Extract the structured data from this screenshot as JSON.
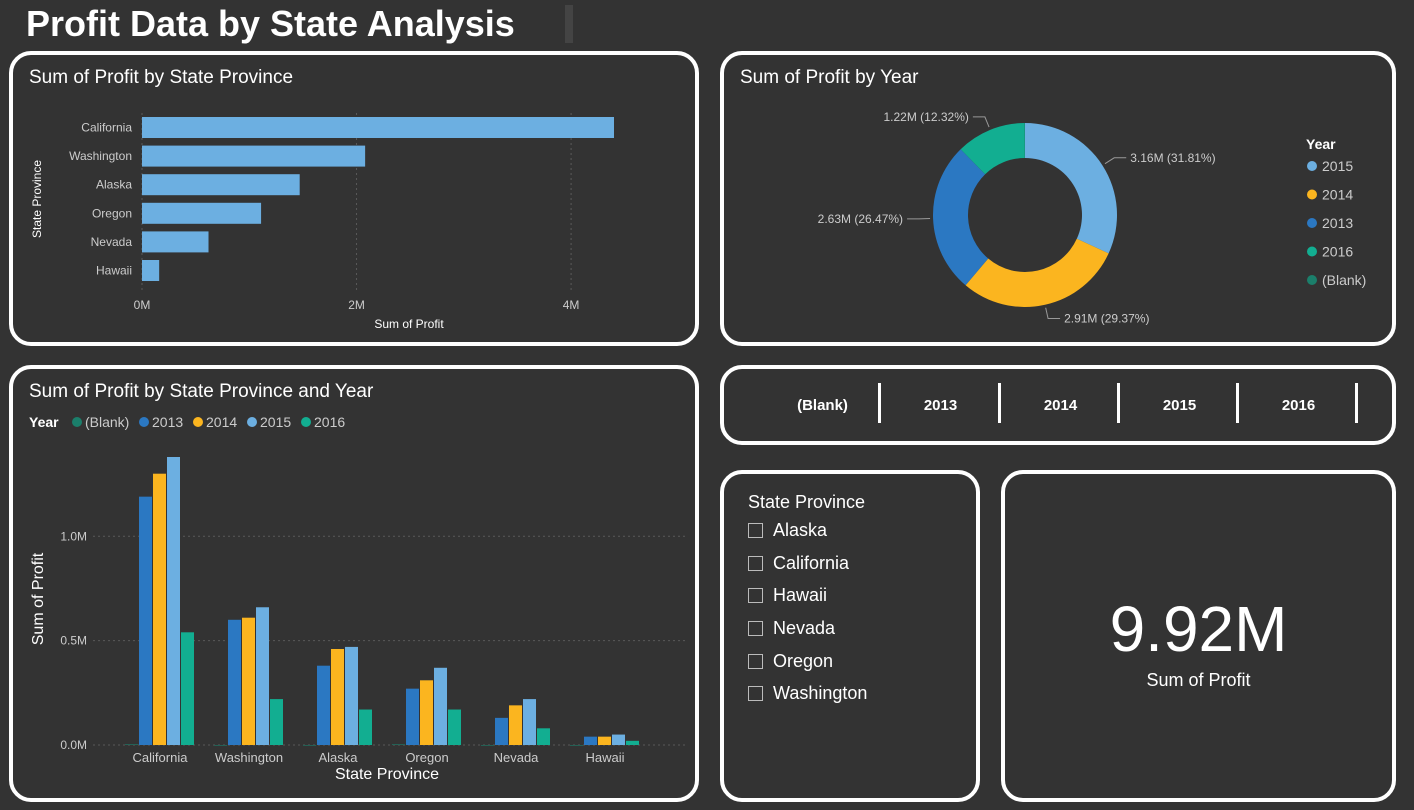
{
  "page": {
    "title": "Profit Data by State Analysis"
  },
  "colors": {
    "(Blank)": "#1b7f6b",
    "2013": "#2b78c2",
    "2014": "#fbb51f",
    "2015": "#6cafe1",
    "2016": "#12ae91",
    "bar": "#6cafe1"
  },
  "chart_data": [
    {
      "type": "bar",
      "orientation": "horizontal",
      "title": "Sum of Profit by State Province",
      "xlabel": "Sum of Profit",
      "ylabel": "State Province",
      "categories": [
        "California",
        "Washington",
        "Alaska",
        "Oregon",
        "Nevada",
        "Hawaii"
      ],
      "values": [
        4.4,
        2.08,
        1.47,
        1.11,
        0.62,
        0.16
      ],
      "unit": "M",
      "xlim": [
        0,
        4.4
      ],
      "xticks": [
        "0M",
        "2M",
        "4M"
      ],
      "grid": true
    },
    {
      "type": "pie",
      "donut": true,
      "title": "Sum of Profit by Year",
      "legend_title": "Year",
      "legend_position": "right",
      "slices": [
        {
          "label": "2015",
          "value": 3.16,
          "pct": 31.81,
          "text": "3.16M (31.81%)"
        },
        {
          "label": "2014",
          "value": 2.91,
          "pct": 29.37,
          "text": "2.91M (29.37%)"
        },
        {
          "label": "2013",
          "value": 2.63,
          "pct": 26.47,
          "text": "2.63M (26.47%)"
        },
        {
          "label": "2016",
          "value": 1.22,
          "pct": 12.32,
          "text": "1.22M (12.32%)"
        },
        {
          "label": "(Blank)",
          "value": 0.003,
          "pct": 0.03,
          "text": ""
        }
      ]
    },
    {
      "type": "bar",
      "orientation": "vertical",
      "title": "Sum of Profit by State Province and Year",
      "xlabel": "State Province",
      "ylabel": "Sum of Profit",
      "legend_title": "Year",
      "legend_position": "top-left",
      "categories": [
        "California",
        "Washington",
        "Alaska",
        "Oregon",
        "Nevada",
        "Hawaii"
      ],
      "series": [
        {
          "name": "(Blank)",
          "values": [
            0.003,
            0.0,
            0.0,
            0.003,
            0.0,
            0.0
          ]
        },
        {
          "name": "2013",
          "values": [
            1.19,
            0.6,
            0.38,
            0.27,
            0.13,
            0.04
          ]
        },
        {
          "name": "2014",
          "values": [
            1.3,
            0.61,
            0.46,
            0.31,
            0.19,
            0.04
          ]
        },
        {
          "name": "2015",
          "values": [
            1.38,
            0.66,
            0.47,
            0.37,
            0.22,
            0.05
          ]
        },
        {
          "name": "2016",
          "values": [
            0.54,
            0.22,
            0.17,
            0.17,
            0.08,
            0.02
          ]
        }
      ],
      "unit": "M",
      "ylim": [
        0,
        1.38
      ],
      "yticks": [
        "0.0M",
        "0.5M",
        "1.0M"
      ],
      "grid": true
    }
  ],
  "year_slicer": {
    "options": [
      "(Blank)",
      "2013",
      "2014",
      "2015",
      "2016"
    ]
  },
  "state_slicer": {
    "title": "State Province",
    "options": [
      "Alaska",
      "California",
      "Hawaii",
      "Nevada",
      "Oregon",
      "Washington"
    ]
  },
  "kpi": {
    "value": "9.92M",
    "label": "Sum of Profit"
  }
}
